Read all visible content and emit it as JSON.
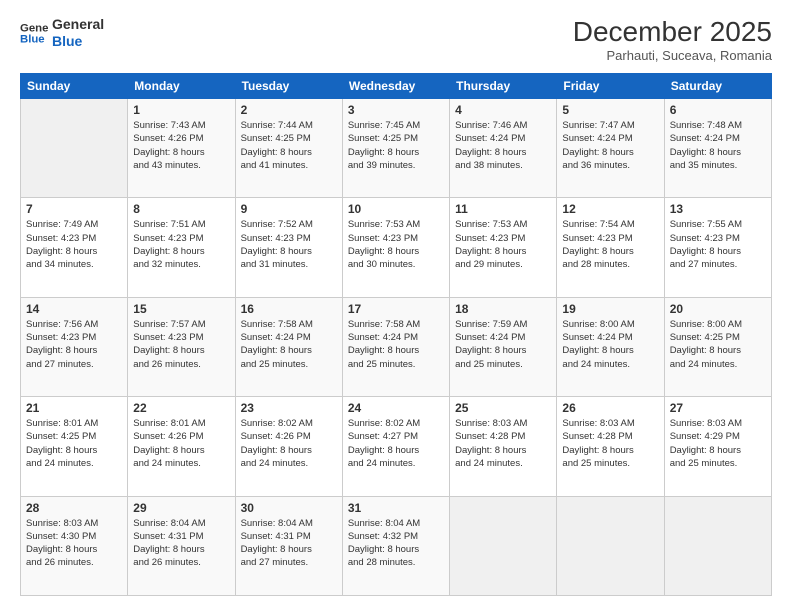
{
  "header": {
    "logo_line1": "General",
    "logo_line2": "Blue",
    "month_title": "December 2025",
    "subtitle": "Parhauti, Suceava, Romania"
  },
  "weekdays": [
    "Sunday",
    "Monday",
    "Tuesday",
    "Wednesday",
    "Thursday",
    "Friday",
    "Saturday"
  ],
  "weeks": [
    [
      {
        "day": "",
        "info": ""
      },
      {
        "day": "1",
        "info": "Sunrise: 7:43 AM\nSunset: 4:26 PM\nDaylight: 8 hours\nand 43 minutes."
      },
      {
        "day": "2",
        "info": "Sunrise: 7:44 AM\nSunset: 4:25 PM\nDaylight: 8 hours\nand 41 minutes."
      },
      {
        "day": "3",
        "info": "Sunrise: 7:45 AM\nSunset: 4:25 PM\nDaylight: 8 hours\nand 39 minutes."
      },
      {
        "day": "4",
        "info": "Sunrise: 7:46 AM\nSunset: 4:24 PM\nDaylight: 8 hours\nand 38 minutes."
      },
      {
        "day": "5",
        "info": "Sunrise: 7:47 AM\nSunset: 4:24 PM\nDaylight: 8 hours\nand 36 minutes."
      },
      {
        "day": "6",
        "info": "Sunrise: 7:48 AM\nSunset: 4:24 PM\nDaylight: 8 hours\nand 35 minutes."
      }
    ],
    [
      {
        "day": "7",
        "info": "Sunrise: 7:49 AM\nSunset: 4:23 PM\nDaylight: 8 hours\nand 34 minutes."
      },
      {
        "day": "8",
        "info": "Sunrise: 7:51 AM\nSunset: 4:23 PM\nDaylight: 8 hours\nand 32 minutes."
      },
      {
        "day": "9",
        "info": "Sunrise: 7:52 AM\nSunset: 4:23 PM\nDaylight: 8 hours\nand 31 minutes."
      },
      {
        "day": "10",
        "info": "Sunrise: 7:53 AM\nSunset: 4:23 PM\nDaylight: 8 hours\nand 30 minutes."
      },
      {
        "day": "11",
        "info": "Sunrise: 7:53 AM\nSunset: 4:23 PM\nDaylight: 8 hours\nand 29 minutes."
      },
      {
        "day": "12",
        "info": "Sunrise: 7:54 AM\nSunset: 4:23 PM\nDaylight: 8 hours\nand 28 minutes."
      },
      {
        "day": "13",
        "info": "Sunrise: 7:55 AM\nSunset: 4:23 PM\nDaylight: 8 hours\nand 27 minutes."
      }
    ],
    [
      {
        "day": "14",
        "info": "Sunrise: 7:56 AM\nSunset: 4:23 PM\nDaylight: 8 hours\nand 27 minutes."
      },
      {
        "day": "15",
        "info": "Sunrise: 7:57 AM\nSunset: 4:23 PM\nDaylight: 8 hours\nand 26 minutes."
      },
      {
        "day": "16",
        "info": "Sunrise: 7:58 AM\nSunset: 4:24 PM\nDaylight: 8 hours\nand 25 minutes."
      },
      {
        "day": "17",
        "info": "Sunrise: 7:58 AM\nSunset: 4:24 PM\nDaylight: 8 hours\nand 25 minutes."
      },
      {
        "day": "18",
        "info": "Sunrise: 7:59 AM\nSunset: 4:24 PM\nDaylight: 8 hours\nand 25 minutes."
      },
      {
        "day": "19",
        "info": "Sunrise: 8:00 AM\nSunset: 4:24 PM\nDaylight: 8 hours\nand 24 minutes."
      },
      {
        "day": "20",
        "info": "Sunrise: 8:00 AM\nSunset: 4:25 PM\nDaylight: 8 hours\nand 24 minutes."
      }
    ],
    [
      {
        "day": "21",
        "info": "Sunrise: 8:01 AM\nSunset: 4:25 PM\nDaylight: 8 hours\nand 24 minutes."
      },
      {
        "day": "22",
        "info": "Sunrise: 8:01 AM\nSunset: 4:26 PM\nDaylight: 8 hours\nand 24 minutes."
      },
      {
        "day": "23",
        "info": "Sunrise: 8:02 AM\nSunset: 4:26 PM\nDaylight: 8 hours\nand 24 minutes."
      },
      {
        "day": "24",
        "info": "Sunrise: 8:02 AM\nSunset: 4:27 PM\nDaylight: 8 hours\nand 24 minutes."
      },
      {
        "day": "25",
        "info": "Sunrise: 8:03 AM\nSunset: 4:28 PM\nDaylight: 8 hours\nand 24 minutes."
      },
      {
        "day": "26",
        "info": "Sunrise: 8:03 AM\nSunset: 4:28 PM\nDaylight: 8 hours\nand 25 minutes."
      },
      {
        "day": "27",
        "info": "Sunrise: 8:03 AM\nSunset: 4:29 PM\nDaylight: 8 hours\nand 25 minutes."
      }
    ],
    [
      {
        "day": "28",
        "info": "Sunrise: 8:03 AM\nSunset: 4:30 PM\nDaylight: 8 hours\nand 26 minutes."
      },
      {
        "day": "29",
        "info": "Sunrise: 8:04 AM\nSunset: 4:31 PM\nDaylight: 8 hours\nand 26 minutes."
      },
      {
        "day": "30",
        "info": "Sunrise: 8:04 AM\nSunset: 4:31 PM\nDaylight: 8 hours\nand 27 minutes."
      },
      {
        "day": "31",
        "info": "Sunrise: 8:04 AM\nSunset: 4:32 PM\nDaylight: 8 hours\nand 28 minutes."
      },
      {
        "day": "",
        "info": ""
      },
      {
        "day": "",
        "info": ""
      },
      {
        "day": "",
        "info": ""
      }
    ]
  ]
}
